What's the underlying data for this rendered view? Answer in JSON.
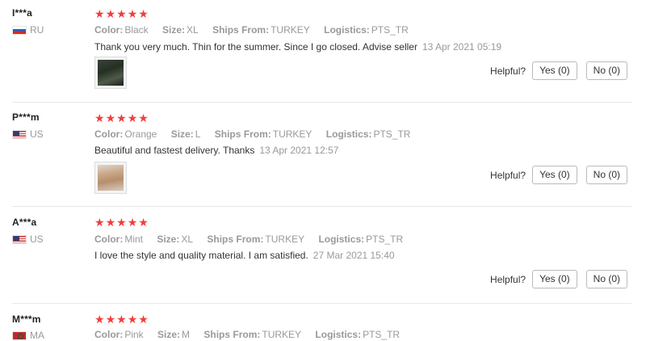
{
  "reviews": [
    {
      "user": "I***a",
      "country": "RU",
      "flag": "ru",
      "stars": 5,
      "color_label": "Color:",
      "color": "Black",
      "size_label": "Size:",
      "size": "XL",
      "ships_label": "Ships From:",
      "ships": "TURKEY",
      "logistics_label": "Logistics:",
      "logistics": "PTS_TR",
      "text": "Thank you very much. Thin for the summer. Since I go closed. Advise seller",
      "date": "13 Apr 2021 05:19",
      "has_photo": true,
      "helpful_label": "Helpful?",
      "yes_label": "Yes (0)",
      "no_label": "No (0)"
    },
    {
      "user": "P***m",
      "country": "US",
      "flag": "us",
      "stars": 5,
      "color_label": "Color:",
      "color": "Orange",
      "size_label": "Size:",
      "size": "L",
      "ships_label": "Ships From:",
      "ships": "TURKEY",
      "logistics_label": "Logistics:",
      "logistics": "PTS_TR",
      "text": "Beautiful and fastest delivery. Thanks",
      "date": "13 Apr 2021 12:57",
      "has_photo": true,
      "helpful_label": "Helpful?",
      "yes_label": "Yes (0)",
      "no_label": "No (0)"
    },
    {
      "user": "A***a",
      "country": "US",
      "flag": "us",
      "stars": 5,
      "color_label": "Color:",
      "color": "Mint",
      "size_label": "Size:",
      "size": "XL",
      "ships_label": "Ships From:",
      "ships": "TURKEY",
      "logistics_label": "Logistics:",
      "logistics": "PTS_TR",
      "text": "I love the style and quality material. I am satisfied.",
      "date": "27 Mar 2021 15:40",
      "has_photo": false,
      "helpful_label": "Helpful?",
      "yes_label": "Yes (0)",
      "no_label": "No (0)"
    },
    {
      "user": "M***m",
      "country": "MA",
      "flag": "ma",
      "stars": 5,
      "color_label": "Color:",
      "color": "Pink",
      "size_label": "Size:",
      "size": "M",
      "ships_label": "Ships From:",
      "ships": "TURKEY",
      "logistics_label": "Logistics:",
      "logistics": "PTS_TR"
    }
  ],
  "colors": {
    "star": "#f33d3d",
    "muted_text": "#999999",
    "body_text": "#333333",
    "divider": "#e8e8e8"
  },
  "icons": {
    "star": "star-icon",
    "flag_ru": "russia-flag-icon",
    "flag_us": "usa-flag-icon",
    "flag_ma": "morocco-flag-icon"
  }
}
